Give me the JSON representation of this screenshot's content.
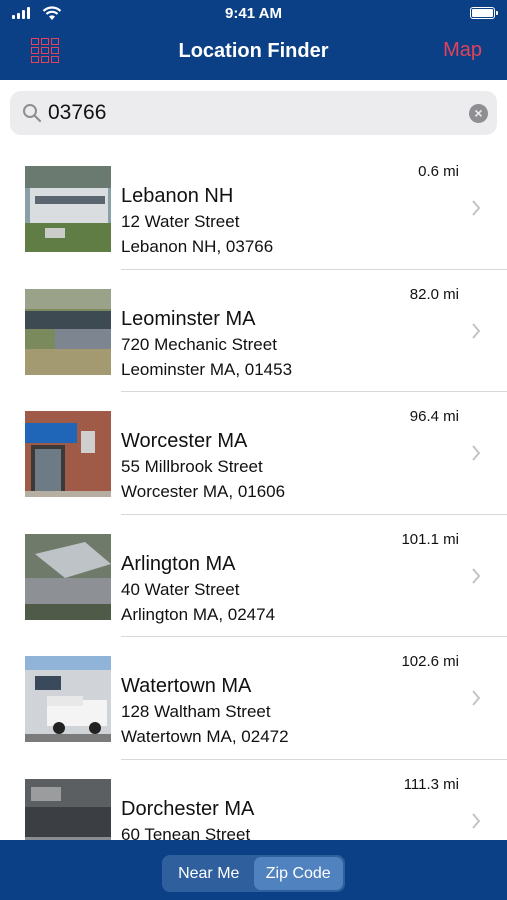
{
  "status_bar": {
    "time": "9:41 AM"
  },
  "nav": {
    "title": "Location Finder",
    "map_label": "Map"
  },
  "search": {
    "value": "03766"
  },
  "locations": [
    {
      "name": "Lebanon NH",
      "street": "12 Water Street",
      "city": "Lebanon NH, 03766",
      "distance": "0.6 mi"
    },
    {
      "name": "Leominster MA",
      "street": "720 Mechanic Street",
      "city": "Leominster MA, 01453",
      "distance": "82.0 mi"
    },
    {
      "name": "Worcester MA",
      "street": "55 Millbrook Street",
      "city": "Worcester MA, 01606",
      "distance": "96.4 mi"
    },
    {
      "name": "Arlington MA",
      "street": "40 Water Street",
      "city": "Arlington MA, 02474",
      "distance": "101.1 mi"
    },
    {
      "name": "Watertown MA",
      "street": "128 Waltham Street",
      "city": "Watertown MA, 02472",
      "distance": "102.6 mi"
    },
    {
      "name": "Dorchester MA",
      "street": "60 Tenean Street",
      "city": "",
      "distance": "111.3 mi"
    }
  ],
  "tabs": {
    "near_me": "Near Me",
    "zip_code": "Zip Code",
    "active": "Zip Code"
  },
  "colors": {
    "header": "#0b3f86",
    "accent": "#e3425a",
    "segment_active": "#4f82bf"
  }
}
